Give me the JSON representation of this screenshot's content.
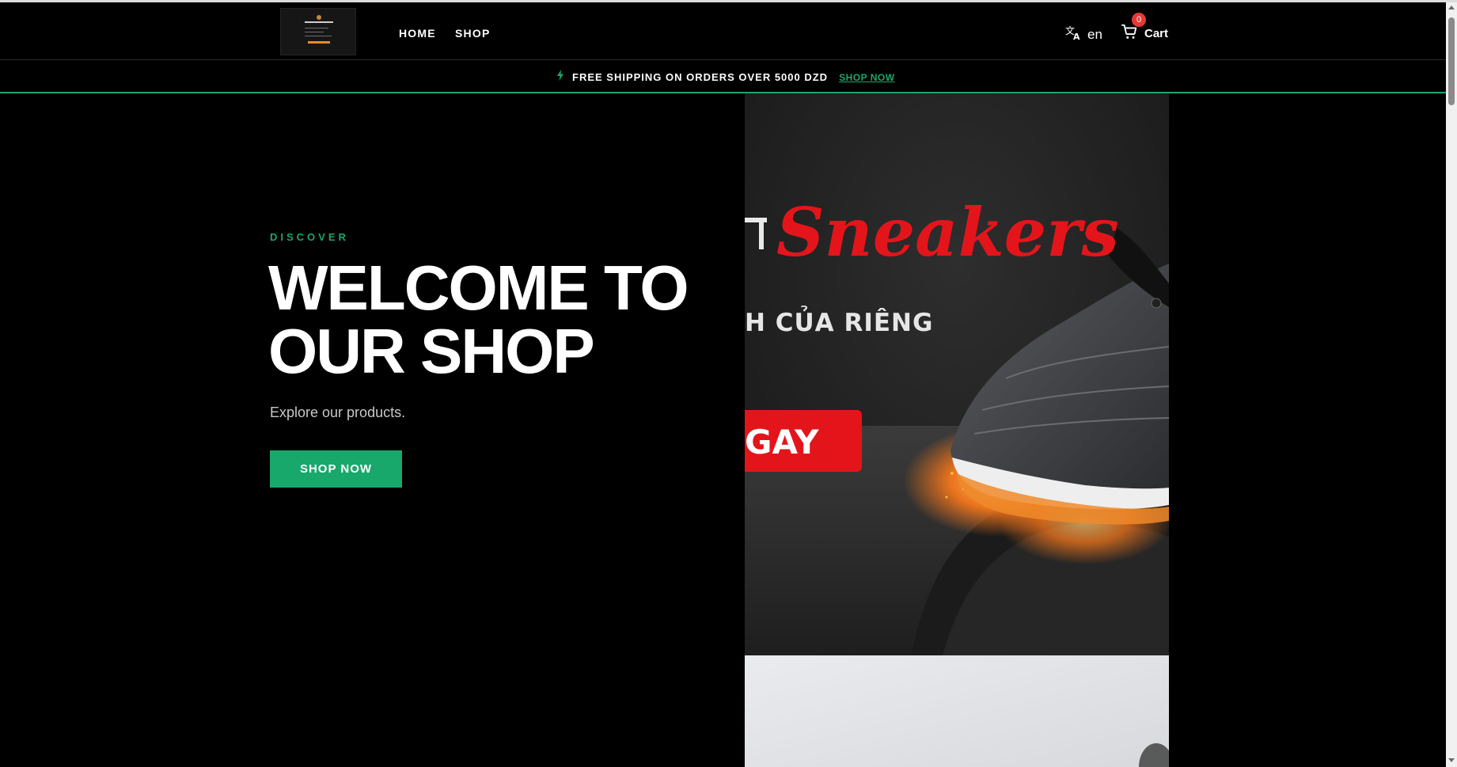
{
  "header": {
    "nav": [
      {
        "label": "HOME"
      },
      {
        "label": "SHOP"
      }
    ],
    "language": "en",
    "cart_label": "Cart",
    "cart_count": "0",
    "logo_icon": "shop-logo-thumbnail"
  },
  "announcement": {
    "icon": "lightning-icon",
    "text": "FREE SHIPPING ON ORDERS OVER 5000 DZD",
    "link": "SHOP NOW"
  },
  "hero": {
    "eyebrow": "DISCOVER",
    "title": "WELCOME TO OUR SHOP",
    "subtitle": "Explore our products.",
    "cta": "SHOP NOW"
  },
  "banner": {
    "script_text": "Sneakers",
    "caption_text": "H CỦA RIÊNG",
    "button_text": "GAY"
  },
  "colors": {
    "accent": "#18a86b",
    "badge": "#e53935",
    "banner_red": "#e3151b"
  }
}
